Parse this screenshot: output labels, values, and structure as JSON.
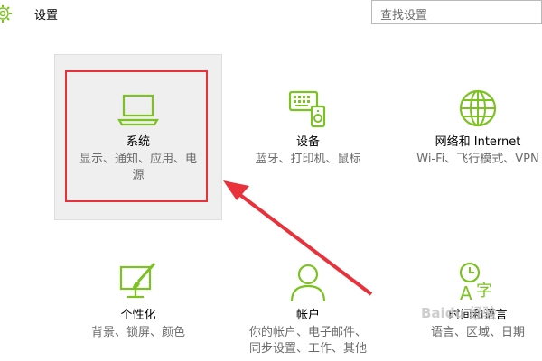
{
  "header": {
    "title": "设置",
    "search_placeholder": "查找设置"
  },
  "tiles": [
    {
      "name": "系统",
      "desc": "显示、通知、应用、电\n源",
      "icon": "laptop-icon"
    },
    {
      "name": "设备",
      "desc": "蓝牙、打印机、鼠标",
      "icon": "devices-icon"
    },
    {
      "name": "网络和 Internet",
      "desc": "Wi-Fi、飞行模式、VPN",
      "icon": "globe-icon"
    },
    {
      "name": "个性化",
      "desc": "背景、锁屏、颜色",
      "icon": "personalization-icon"
    },
    {
      "name": "帐户",
      "desc": "你的帐户、电子邮件、\n同步设置、工作、其他",
      "icon": "person-icon"
    },
    {
      "name": "时间和语言",
      "desc": "语言、区域、日期",
      "icon": "time-language-icon"
    }
  ],
  "watermark": "Baidu 经验",
  "colors": {
    "accent": "#7cc222",
    "highlight_box": "#e8313b",
    "selected_bg": "#efefef"
  }
}
